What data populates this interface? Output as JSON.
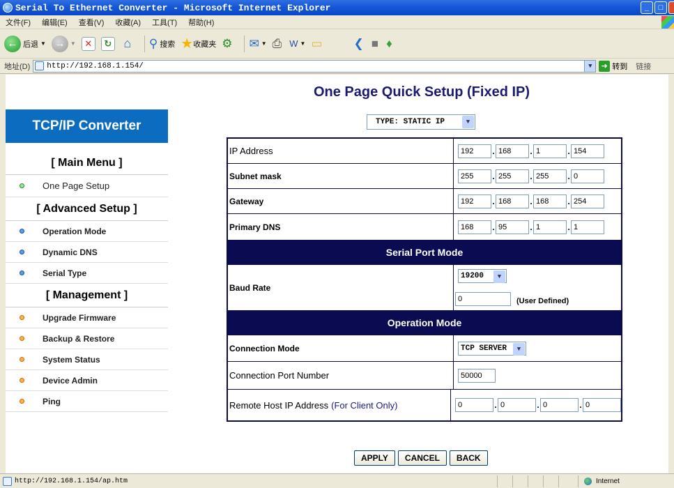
{
  "window": {
    "title": "Serial To Ethernet Converter - Microsoft Internet Explorer",
    "buttons": {
      "minimize": "_",
      "maximize": "□",
      "close": "X"
    }
  },
  "menu": [
    "文件(F)",
    "编辑(E)",
    "查看(V)",
    "收藏(A)",
    "工具(T)",
    "帮助(H)"
  ],
  "toolbar": {
    "back": "后退",
    "search": "搜索",
    "favorites": "收藏夹"
  },
  "address": {
    "label": "地址(D)",
    "url": "http://192.168.1.154/",
    "go": "转到",
    "links": "链接"
  },
  "page": {
    "title": "One Page Quick Setup (Fixed IP)",
    "type_select": "TYPE: STATIC IP"
  },
  "sidebar": {
    "header": "TCP/IP Converter",
    "main_menu": "[ Main Menu ]",
    "one_page_setup": "One Page Setup",
    "advanced_setup": "[ Advanced Setup ]",
    "advanced_items": [
      "Operation Mode",
      "Dynamic DNS",
      "Serial Type"
    ],
    "management": "[ Management ]",
    "management_items": [
      "Upgrade Firmware",
      "Backup & Restore",
      "System Status",
      "Device Admin",
      "Ping"
    ]
  },
  "network": {
    "ip_label": "IP Address",
    "ip": [
      "192",
      "168",
      "1",
      "154"
    ],
    "mask_label": "Subnet mask",
    "mask": [
      "255",
      "255",
      "255",
      "0"
    ],
    "gateway_label": "Gateway",
    "gateway": [
      "192",
      "168",
      "168",
      "254"
    ],
    "dns_label": "Primary DNS",
    "dns": [
      "168",
      "95",
      "1",
      "1"
    ]
  },
  "serial": {
    "header": "Serial Port Mode",
    "baud_label": "Baud Rate",
    "baud_value": "19200",
    "user_defined_value": "0",
    "user_defined_label": "(User Defined)"
  },
  "operation": {
    "header": "Operation Mode",
    "conn_mode_label": "Connection Mode",
    "conn_mode_value": "TCP SERVER",
    "port_label": "Connection Port Number",
    "port_value": "50000",
    "remote_label": "Remote Host IP Address",
    "remote_note": "(For Client Only)",
    "remote_ip": [
      "0",
      "0",
      "0",
      "0"
    ]
  },
  "actions": {
    "apply": "APPLY",
    "cancel": "CANCEL",
    "back": "BACK"
  },
  "status": {
    "url": "http://192.168.1.154/ap.htm",
    "zone": "Internet"
  }
}
